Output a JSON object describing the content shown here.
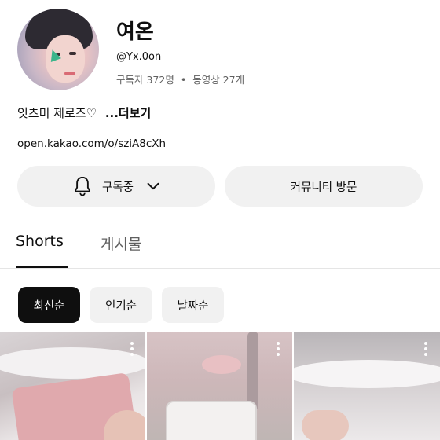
{
  "channel": {
    "name": "여온",
    "handle": "@Yx.0on",
    "subscribers": "구독자 372명",
    "separator": "•",
    "videos": "동영상 27개",
    "bio": "잇츠미 제로즈♡",
    "bio_more": "...더보기",
    "link": "open.kakao.com/o/sziA8cXh"
  },
  "actions": {
    "subscribed_label": "구독중",
    "community_label": "커뮤니티 방문"
  },
  "tabs": [
    {
      "label": "Shorts",
      "active": true
    },
    {
      "label": "게시물",
      "active": false
    }
  ],
  "sort_chips": [
    {
      "label": "최신순",
      "selected": true
    },
    {
      "label": "인기순",
      "selected": false
    },
    {
      "label": "날짜순",
      "selected": false
    }
  ],
  "icons": {
    "bell": "bell-icon",
    "chevron": "chevron-down-icon",
    "more": "more-vert-icon"
  },
  "colors": {
    "text": "#0f0f0f",
    "secondary_text": "#606060",
    "chip_bg": "#f1f1f1",
    "chip_selected_bg": "#0f0f0f"
  }
}
